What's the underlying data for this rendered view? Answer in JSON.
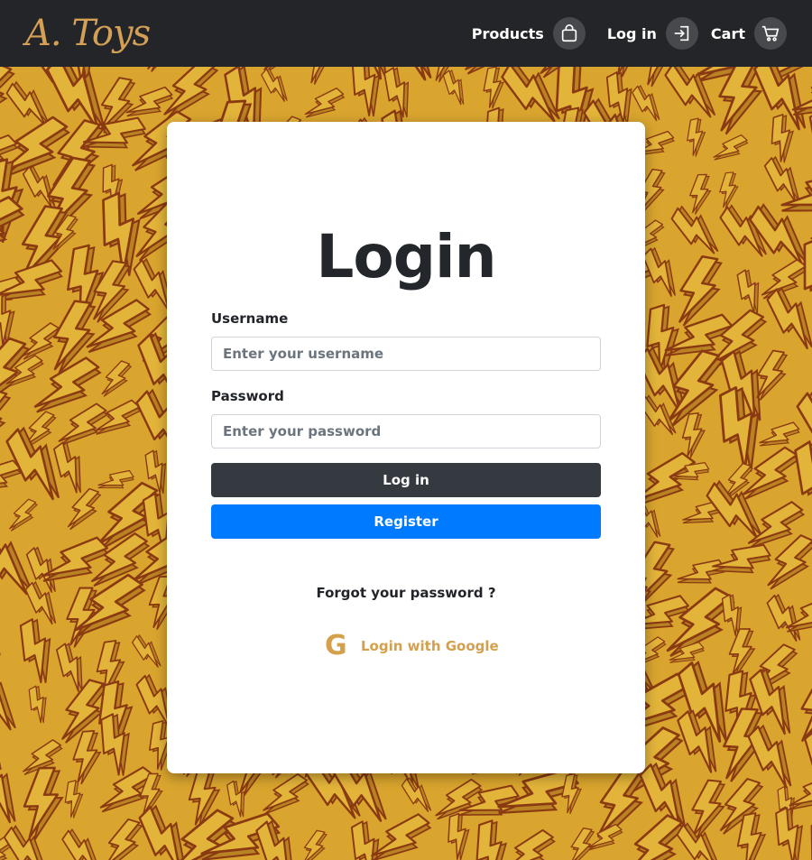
{
  "brand": "A. Toys",
  "nav": {
    "products": "Products",
    "login": "Log in",
    "cart": "Cart"
  },
  "icons": {
    "products": "shopping-bag-icon",
    "login": "login-arrow-icon",
    "cart": "cart-icon",
    "google": "google-g-icon"
  },
  "colors": {
    "navbar_bg": "#232528",
    "brand": "#d4a055",
    "background": "#d9a52e",
    "pattern_stroke": "#8a3a12",
    "login_button": "#343a40",
    "register_button": "#007bff",
    "google_link": "#d4a04c"
  },
  "form": {
    "title": "Login",
    "username_label": "Username",
    "username_placeholder": "Enter your username",
    "username_value": "",
    "password_label": "Password",
    "password_placeholder": "Enter your password",
    "password_value": "",
    "login_button": "Log in",
    "register_button": "Register",
    "forgot": "Forgot your password ?",
    "google_letter": "G",
    "google_login": "Login with Google"
  }
}
